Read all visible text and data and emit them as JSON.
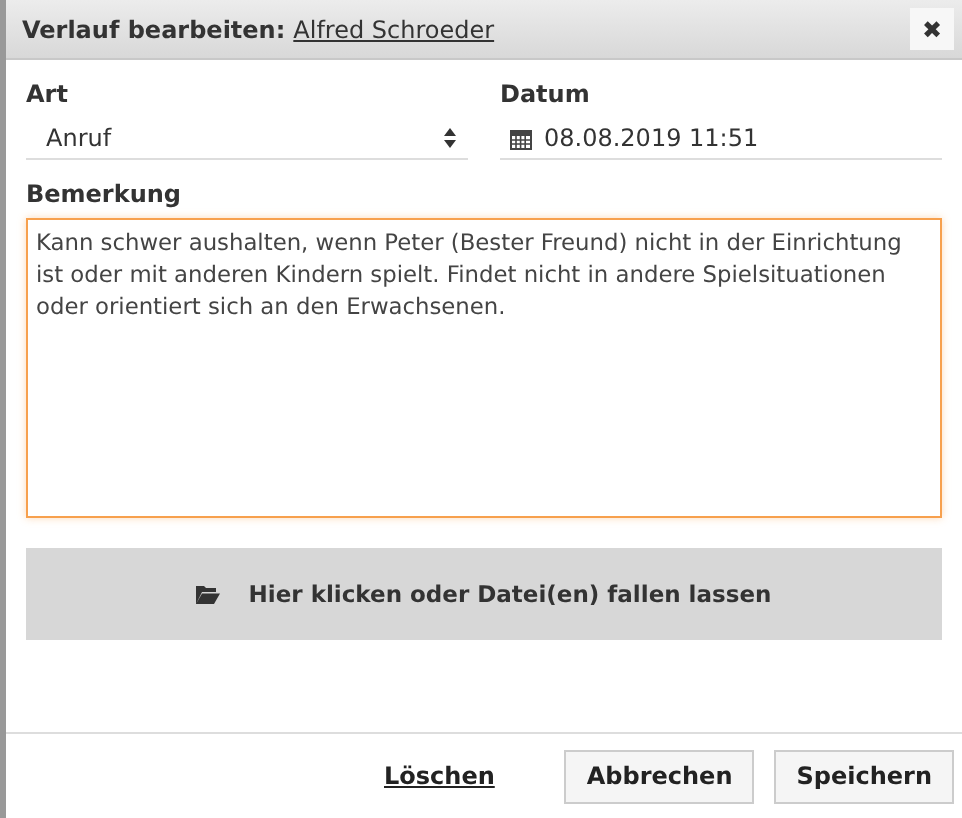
{
  "dialog": {
    "title": "Verlauf bearbeiten:",
    "title_link": "Alfred Schroeder",
    "close": "✖"
  },
  "art": {
    "label": "Art",
    "value": "Anruf"
  },
  "datum": {
    "label": "Datum",
    "value": "08.08.2019 11:51"
  },
  "bemerkung": {
    "label": "Bemerkung",
    "value": "Kann schwer aushalten, wenn Peter (Bester Freund) nicht in der Einrichtung ist oder mit anderen Kindern spielt. Findet nicht in andere Spielsituationen oder orientiert sich an den Erwachsenen.",
    "focused": true
  },
  "dropzone": {
    "label": "Hier klicken oder Datei(en) fallen lassen"
  },
  "footer": {
    "delete_link": "Löschen",
    "buttons": [
      "Abbrechen",
      "Speichern"
    ]
  }
}
